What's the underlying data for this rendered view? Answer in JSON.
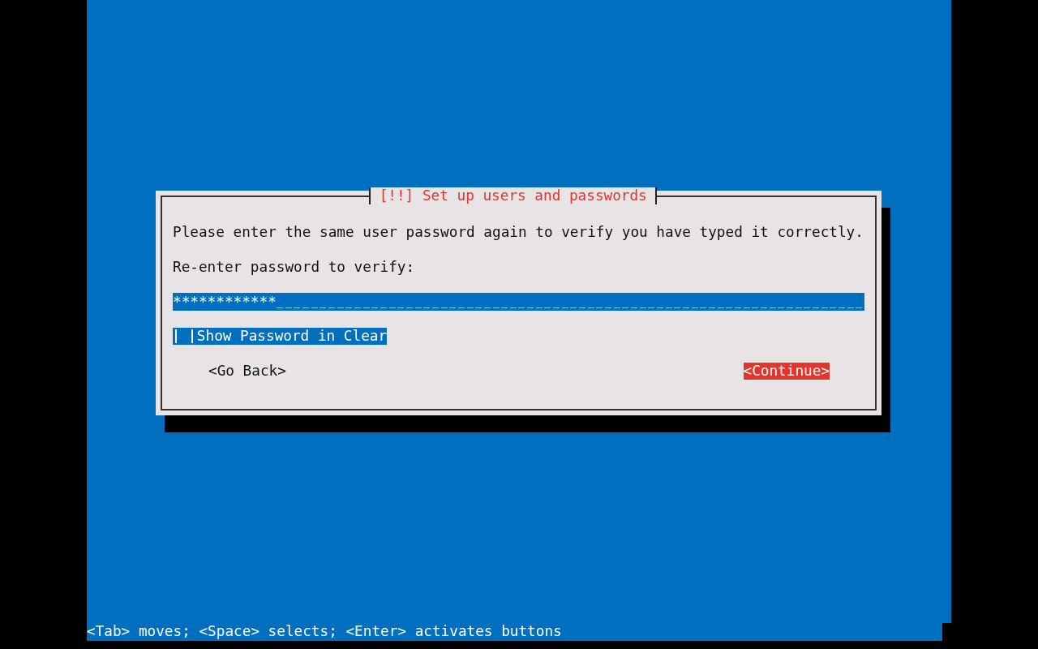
{
  "dialog": {
    "title": "[!!] Set up users and passwords",
    "message": "Please enter the same user password again to verify you have typed it correctly.",
    "field": {
      "label": "Re-enter password to verify:",
      "value": "************",
      "focused": true
    },
    "checkbox": {
      "label": "Show Password in Clear",
      "checked": false,
      "focused": true
    },
    "buttons": [
      {
        "label": "<Go Back>",
        "selected": false
      },
      {
        "label": "<Continue>",
        "selected": true
      }
    ]
  },
  "status_bar": "<Tab> moves; <Space> selects; <Enter> activates buttons"
}
